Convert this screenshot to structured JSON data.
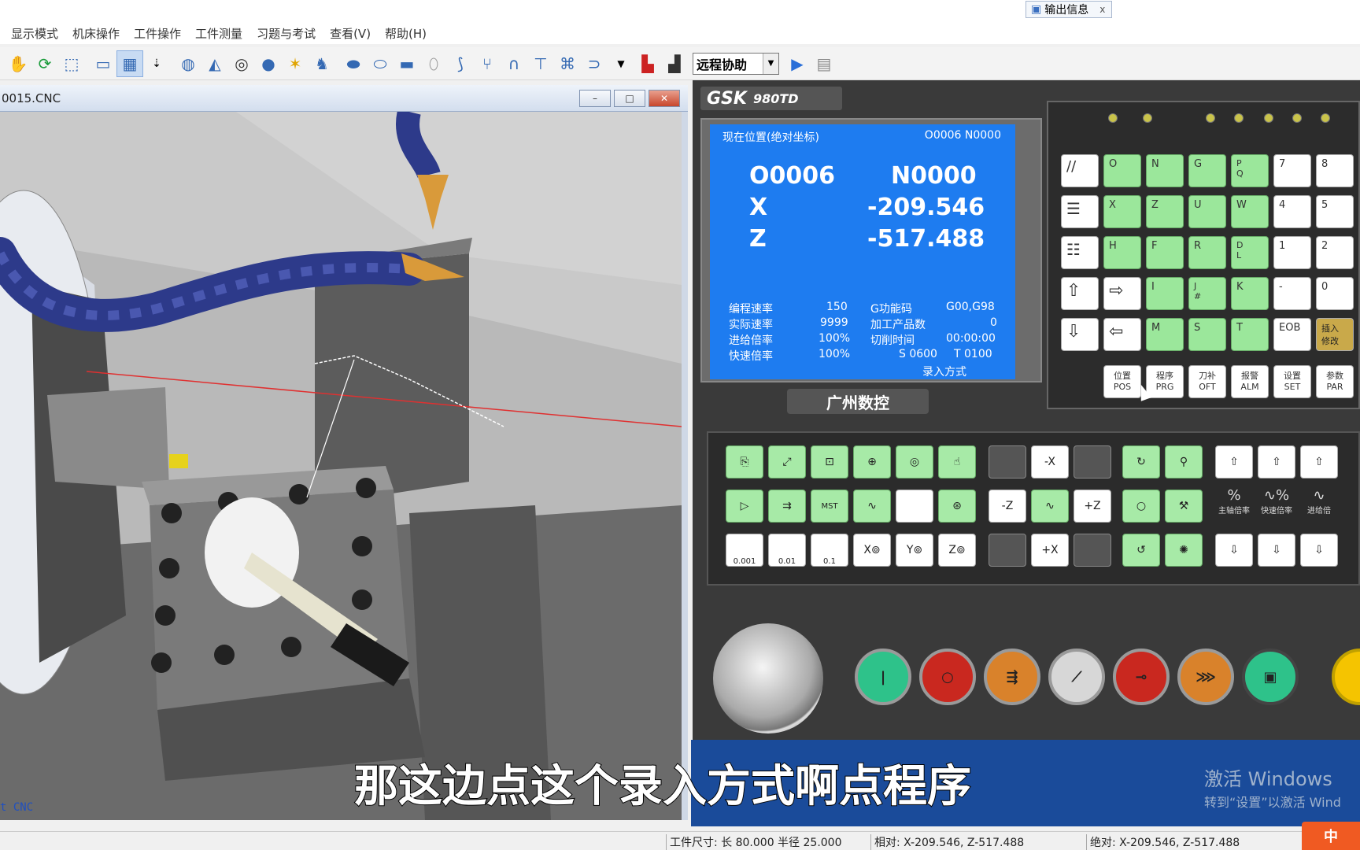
{
  "output_tab": {
    "label": "输出信息",
    "close": "x"
  },
  "menu": [
    "显示模式",
    "机床操作",
    "工件操作",
    "工件测量",
    "习题与考试",
    "查看(V)",
    "帮助(H)"
  ],
  "toolbar": {
    "combo_value": "远程协助"
  },
  "sim_window": {
    "title": "0015.CNC",
    "btn_min": "–",
    "btn_max": "□",
    "btn_close": "✕",
    "scene_text": "t CNC"
  },
  "panel": {
    "brand": "GSK",
    "model": "980TD",
    "maker": "广州数控",
    "screen": {
      "header": "现在位置(绝对坐标)",
      "header_right": "O0006  N0000",
      "o_label": "O0006",
      "n_label": "N0000",
      "x_label": "X",
      "x_value": "-209.546",
      "z_label": "Z",
      "z_value": "-517.488",
      "rows": [
        {
          "k": "编程速率",
          "v": "150",
          "k2": "G功能码",
          "v2": "G00,G98"
        },
        {
          "k": "实际速率",
          "v": "9999",
          "k2": "加工产品数",
          "v2": "0"
        },
        {
          "k": "进给倍率",
          "v": "100%",
          "k2": "切削时间",
          "v2": "00:00:00"
        },
        {
          "k": "快速倍率",
          "v": "100%",
          "k2": "S  0600",
          "v2": "T 0100"
        }
      ],
      "mode": "录入方式"
    },
    "keys_row1": [
      "//",
      "O",
      "N",
      "G",
      "P\nQ",
      "7",
      "8"
    ],
    "keys_row2": [
      "",
      "X",
      "Z",
      "U",
      "W",
      "4",
      "5"
    ],
    "keys_row3": [
      "",
      "H",
      "F",
      "R",
      "D\nL",
      "1",
      "2"
    ],
    "keys_row4": [
      "⇧",
      "⇨",
      "I",
      "J\n#",
      "K",
      "-",
      "0"
    ],
    "keys_row5": [
      "⇩",
      "⇦",
      "M",
      "S",
      "T",
      "EOB",
      "插入\n修改"
    ],
    "func_keys": [
      {
        "a": "位置",
        "b": "POS"
      },
      {
        "a": "程序",
        "b": "PRG"
      },
      {
        "a": "刀补",
        "b": "OFT"
      },
      {
        "a": "报警",
        "b": "ALM"
      },
      {
        "a": "设置",
        "b": "SET"
      },
      {
        "a": "参数",
        "b": "PAR"
      }
    ],
    "axis_keys": {
      "mx": "-X",
      "mz": "-Z",
      "pz": "+Z",
      "px": "+X"
    },
    "step_keys": [
      "0.001",
      "0.01",
      "0.1",
      "X⊚",
      "Y⊚",
      "Z⊚"
    ],
    "override_labels": [
      "主轴倍率",
      "快速倍率",
      "进给倍"
    ]
  },
  "subtitle": "那这边点这个录入方式啊点程序",
  "watermark": {
    "line1": "激活 Windows",
    "line2": "转到“设置”以激活 Wind"
  },
  "status": {
    "size": "工件尺寸: 长  80.000 半径  25.000",
    "rel": "相对: X-209.546, Z-517.488",
    "abs": "绝对: X-209.546, Z-517.488"
  },
  "ime": "中"
}
